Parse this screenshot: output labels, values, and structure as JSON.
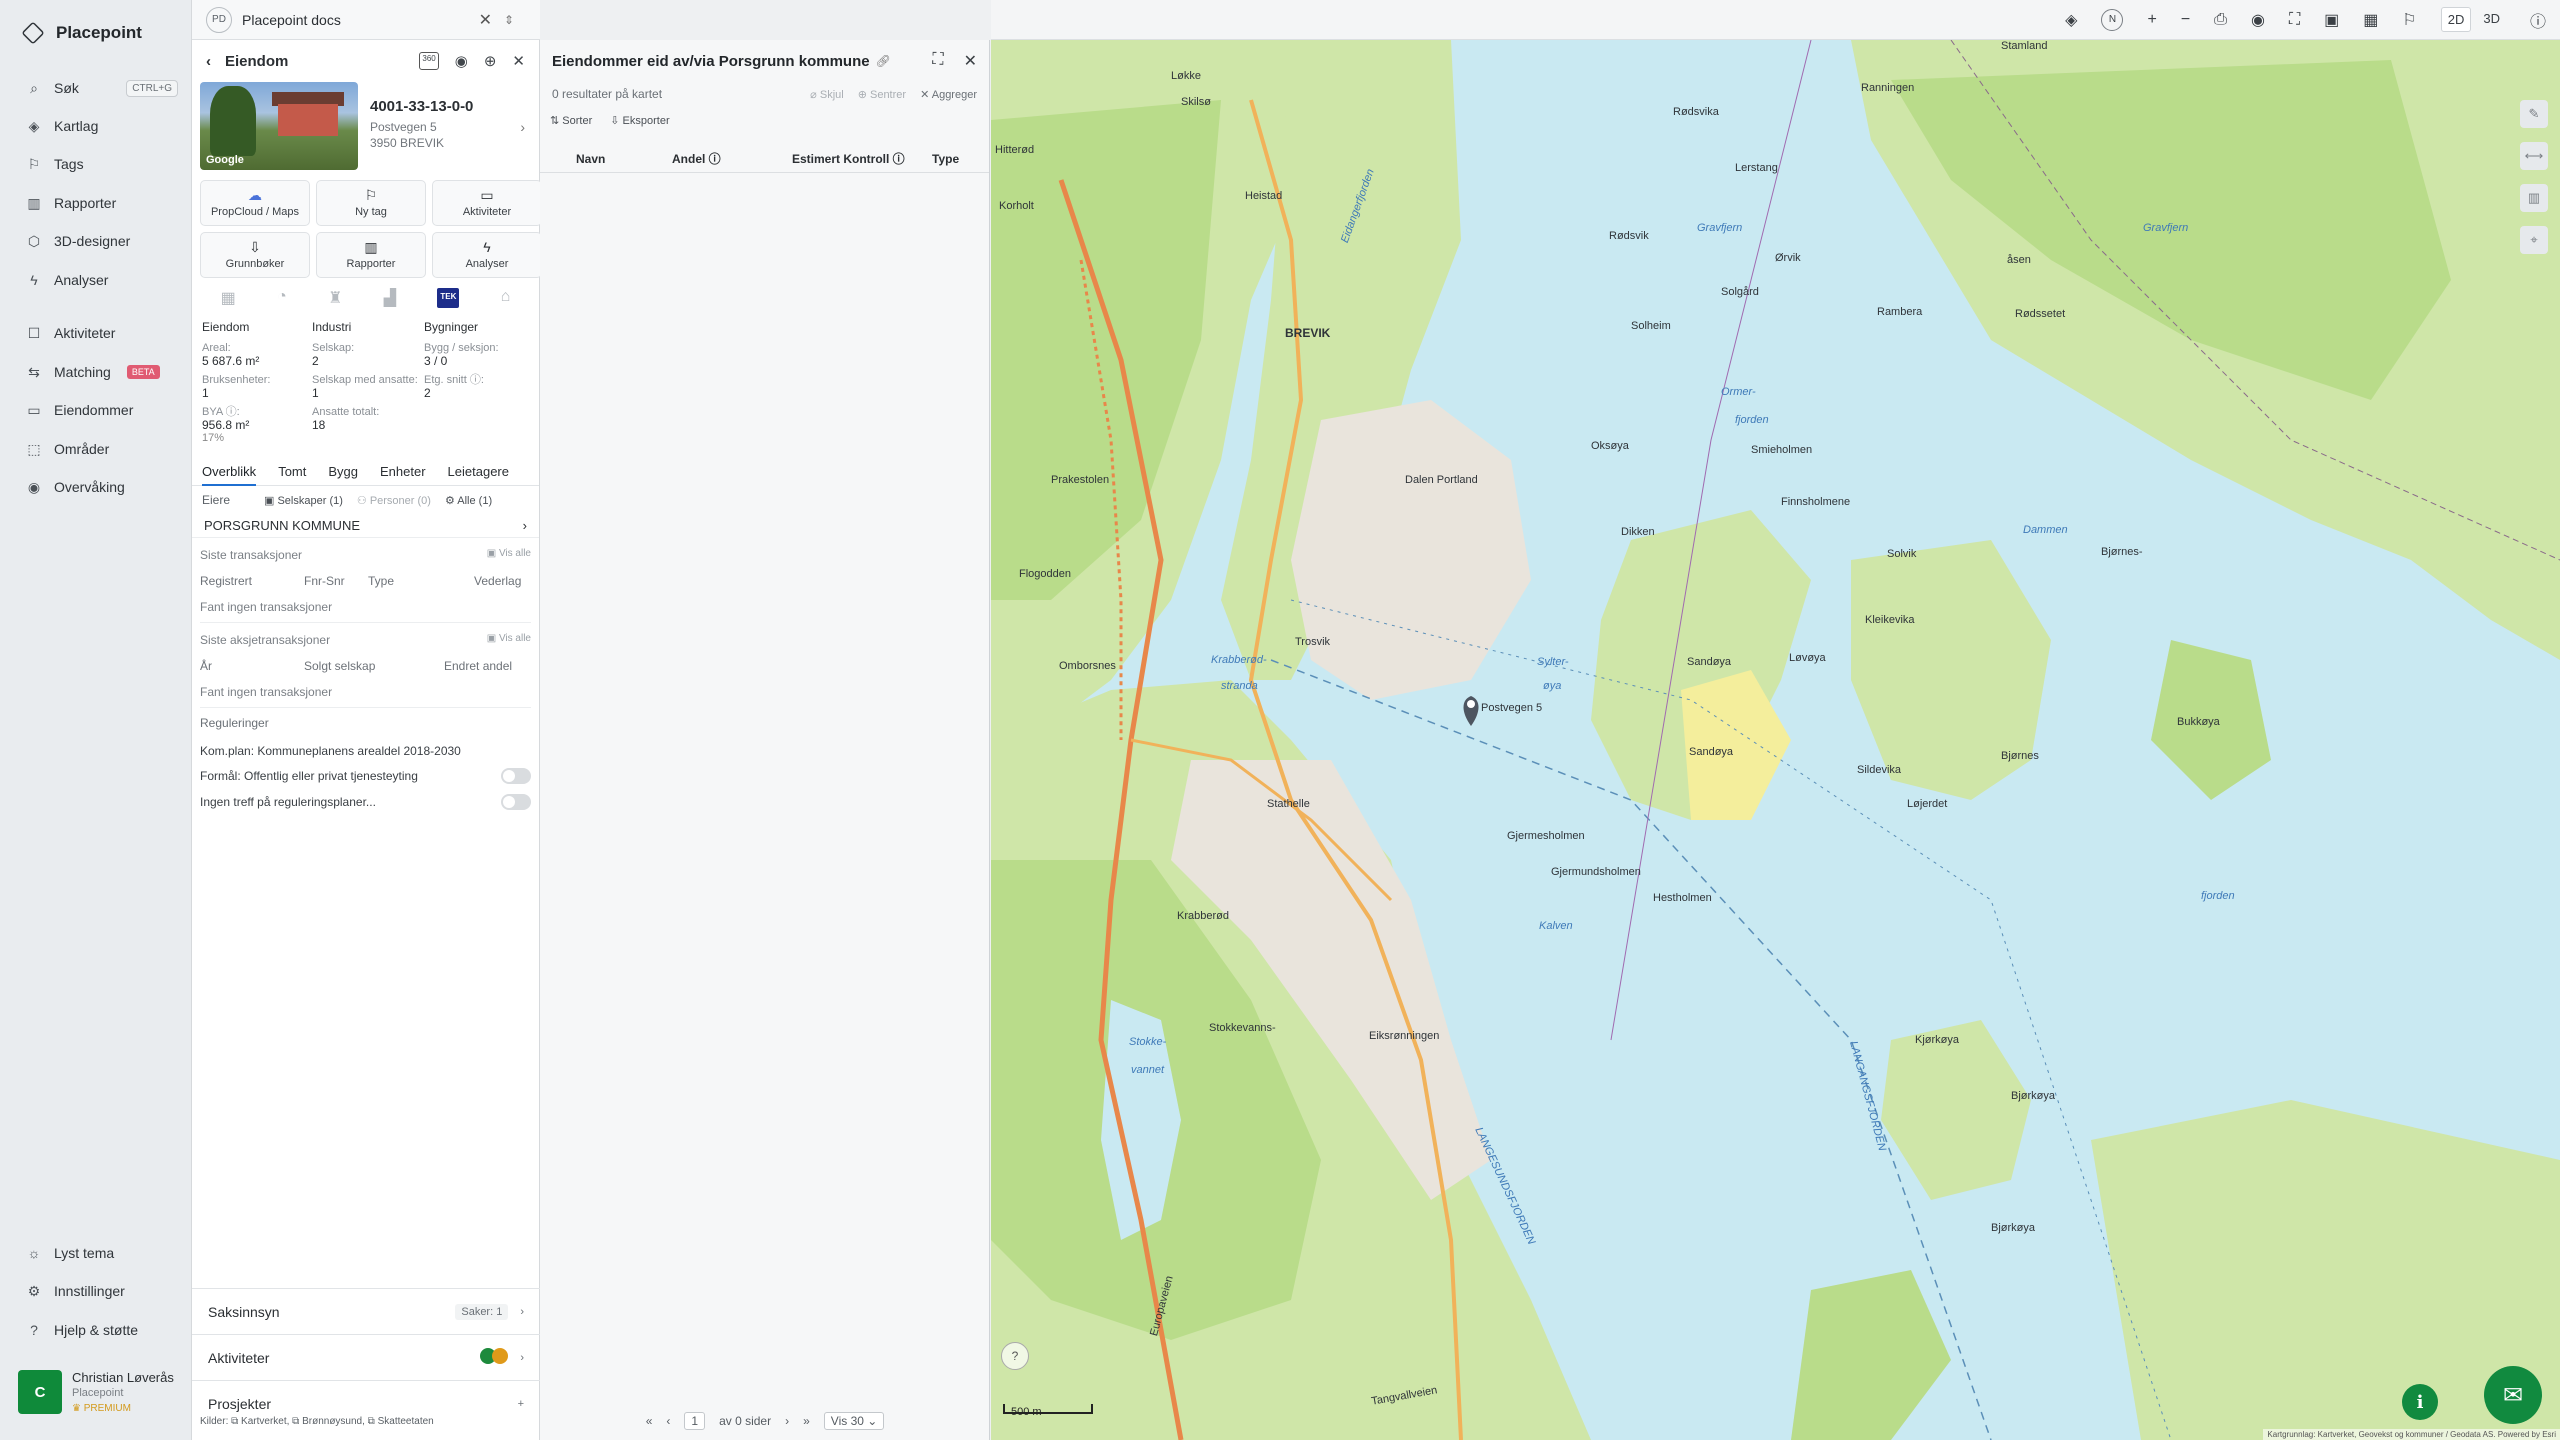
{
  "app": {
    "name": "Placepoint"
  },
  "nav": {
    "items": [
      {
        "label": "Søk",
        "icon": "search-icon",
        "glyph": "⌕",
        "shortcut": "CTRL+G"
      },
      {
        "label": "Kartlag",
        "icon": "layers-icon",
        "glyph": "◈"
      },
      {
        "label": "Tags",
        "icon": "bookmark-icon",
        "glyph": "⚐"
      },
      {
        "label": "Rapporter",
        "icon": "chart-icon",
        "glyph": "▥"
      },
      {
        "label": "3D-designer",
        "icon": "cube-icon",
        "glyph": "⬡"
      },
      {
        "label": "Analyser",
        "icon": "lightning-icon",
        "glyph": "ϟ"
      },
      {
        "label": "Aktiviteter",
        "icon": "chat-icon",
        "glyph": "☐"
      },
      {
        "label": "Matching",
        "icon": "match-icon",
        "glyph": "⇆",
        "badge": "BETA"
      },
      {
        "label": "Eiendommer",
        "icon": "property-icon",
        "glyph": "▭"
      },
      {
        "label": "Områder",
        "icon": "area-icon",
        "glyph": "⬚"
      },
      {
        "label": "Overvåking",
        "icon": "eye-icon",
        "glyph": "◉"
      }
    ],
    "bottom": [
      {
        "label": "Lyst tema",
        "icon": "sun-icon",
        "glyph": "☼"
      },
      {
        "label": "Innstillinger",
        "icon": "gear-icon",
        "glyph": "⚙"
      },
      {
        "label": "Hjelp & støtte",
        "icon": "help-icon",
        "glyph": "?"
      }
    ],
    "user": {
      "initial": "C",
      "name": "Christian Løverås",
      "org": "Placepoint",
      "plan": "PREMIUM"
    }
  },
  "doc_tab": {
    "badge": "PD",
    "title": "Placepoint docs"
  },
  "property": {
    "header": "Eiendom",
    "badge_360": "360",
    "id": "4001-33-13-0-0",
    "address": "Postvegen 5",
    "postal": "3950 BREVIK",
    "thumb_label": "Google",
    "actions": [
      {
        "label": "PropCloud / Maps",
        "icon": "cloud-icon",
        "glyph": "☁"
      },
      {
        "label": "Ny tag",
        "icon": "tag-icon",
        "glyph": "⚐"
      },
      {
        "label": "Aktiviteter",
        "icon": "chat-icon",
        "glyph": "▭"
      },
      {
        "label": "Grunnbøker",
        "icon": "download-icon",
        "glyph": "⇩"
      },
      {
        "label": "Rapporter",
        "icon": "chart-icon",
        "glyph": "▥"
      },
      {
        "label": "Analyser",
        "icon": "lightning-icon",
        "glyph": "ϟ"
      }
    ],
    "tek_label": "TEK",
    "stats": {
      "col1": {
        "heading": "Eiendom",
        "areal_label": "Areal:",
        "areal": "5 687.6 m²",
        "bruk_label": "Bruksenheter:",
        "bruk": "1",
        "bya_label": "BYA ⓘ:",
        "bya": "956.8 m²",
        "bya_pct": "17%"
      },
      "col2": {
        "heading": "Industri",
        "selskap_label": "Selskap:",
        "selskap": "2",
        "ansatte_label": "Selskap med ansatte:",
        "ansatte": "1",
        "totalt_label": "Ansatte totalt:",
        "totalt": "18"
      },
      "col3": {
        "heading": "Bygninger",
        "bygg_label": "Bygg / seksjon:",
        "bygg": "3 / 0",
        "etg_label": "Etg. snitt ⓘ:",
        "etg": "2"
      }
    },
    "tabs": [
      "Overblikk",
      "Tomt",
      "Bygg",
      "Enheter",
      "Leietagere"
    ],
    "owners": {
      "label": "Eiere",
      "f1": "Selskaper (1)",
      "f2": "Personer (0)",
      "f3": "Alle (1)",
      "name": "PORSGRUNN KOMMUNE"
    },
    "transactions": {
      "title": "Siste transaksjoner",
      "show_all": "Vis alle",
      "cols": [
        "Registrert",
        "Fnr-Snr",
        "Type",
        "Vederlag"
      ],
      "empty": "Fant ingen transaksjoner"
    },
    "share_tx": {
      "title": "Siste aksjetransaksjoner",
      "show_all": "Vis alle",
      "cols": [
        "År",
        "Solgt selskap",
        "Endret andel"
      ],
      "empty": "Fant ingen transaksjoner"
    },
    "regulations": {
      "title": "Reguleringer",
      "plan": "Kom.plan: Kommuneplanens arealdel 2018-2030",
      "purpose": "Formål: Offentlig eller privat tjenesteyting",
      "none": "Ingen treff på reguleringsplaner..."
    },
    "saksinnsyn": {
      "label": "Saksinnsyn",
      "count": "Saker: 1"
    },
    "aktiviteter": {
      "label": "Aktiviteter"
    },
    "prosjekter": {
      "label": "Prosjekter",
      "add": "+"
    },
    "sources": "Kilder: ⧉ Kartverket, ⧉ Brønnøysund, ⧉ Skatteetaten"
  },
  "results": {
    "title": "Eiendommer eid av/via Porsgrunn kommune",
    "count": "0 resultater på kartet",
    "hide": "Skjul",
    "center": "Sentrer",
    "aggregate": "Aggreger",
    "sort": "Sorter",
    "export": "Eksporter",
    "columns": [
      "Navn",
      "Andel ⓘ",
      "Estimert Kontroll ⓘ",
      "Type"
    ],
    "pager": {
      "page": "1",
      "of": "av 0 sider",
      "per": "Vis 30"
    }
  },
  "map": {
    "mode_2d": "2D",
    "mode_3d": "3D",
    "compass": "N",
    "scale": "500 m",
    "attribution": "Kartgrunnlag: Kartverket, Geovekst og kommuner / Geodata AS. Powered by Esri",
    "labels": {
      "brevik": "BREVIK",
      "heistad": "Heistad",
      "lokke": "Løkke",
      "hitterod": "Hitterød",
      "korholt": "Korholt",
      "skilsa": "Skilsø",
      "eidanger": "Eidangerfjorden",
      "rodsvika": "Rødsvika",
      "rodsvik": "Rødsvik",
      "rannningen": "Ranningen",
      "lerstang": "Lerstang",
      "stamland": "Stamland",
      "solgard": "Solgård",
      "solheim": "Solheim",
      "orvik": "Ørvik",
      "rambera": "Rambera",
      "gravfjern": "Gravfjern",
      "gravfjern2": "Gravfjern",
      "asen": "åsen",
      "rodssetet": "Rødssetet",
      "dalen": "Dalen Portland",
      "oksoya": "Oksøya",
      "ormer": "Ormer-",
      "fjorden": "fjorden",
      "smieholmen": "Smieholmen",
      "prakestolen": "Prakestolen",
      "finnsholmene": "Finnsholmene",
      "dikken": "Dikken",
      "flogodden": "Flogodden",
      "omborsnes": "Omborsnes",
      "krabberod": "Krabberød-",
      "stranda": "stranda",
      "trosvik": "Trosvik",
      "sandoya": "Sandøya",
      "sandoya2": "Sandøya",
      "lovoya": "Løvøya",
      "syltera": "Sylter-",
      "oya": "øya",
      "addr_pin": "Postvegen 5",
      "stathelle": "Stathelle",
      "gjerme": "Gjermesholmen",
      "gjermunds": "Gjermundsholmen",
      "kalven": "Kalven",
      "hestholmen": "Hestholmen",
      "krabberod2": "Krabberød",
      "stokke": "Stokke-",
      "vannet": "vannet",
      "stokkevanns": "Stokkevanns-",
      "eiksronningen": "Eiksrønningen",
      "langesund": "LANGESUNDSFJORDEN",
      "langangs": "LANGANGSFJORDEN",
      "solvik": "Solvik",
      "bjornes": "Bjørnes-",
      "bukkoya": "Bukkøya",
      "sildevika": "Sildevika",
      "bjornes2": "Bjørnes",
      "lojerdet": "Løjerdet",
      "fjorden2": "fjorden",
      "kjorkoya": "Kjørkøya",
      "bjorkoya": "Bjørkøya",
      "bjorkoya2": "Bjørkøya",
      "damen": "Dammen",
      "kleikevika": "Kleikevika",
      "tangvallveien": "Tangvallveien",
      "europaveien": "Europaveien"
    }
  }
}
